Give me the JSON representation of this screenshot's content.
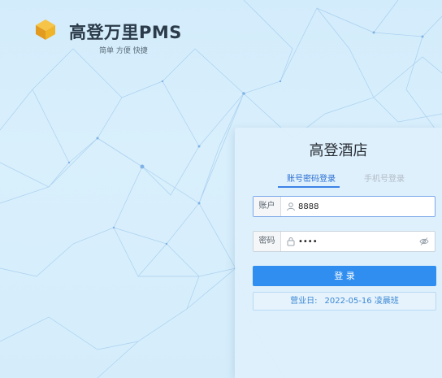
{
  "brand": {
    "name": "高登万里PMS",
    "slogan": "简单 方便 快捷",
    "logo_icon": "cube-logo-icon"
  },
  "login": {
    "hotel_name": "高登酒店",
    "tabs": [
      {
        "label": "账号密码登录",
        "active": true
      },
      {
        "label": "手机号登录",
        "active": false
      }
    ],
    "account": {
      "label": "账户",
      "value": "8888",
      "icon": "user-icon"
    },
    "password": {
      "label": "密码",
      "value": "1234",
      "icon": "lock-icon",
      "toggle_icon": "eye-off-icon"
    },
    "submit_label": "登 录",
    "business_day": {
      "label": "营业日:",
      "value": "2022-05-16 凌晨班"
    }
  },
  "colors": {
    "primary": "#2f8ef0",
    "background": "#d6eefc",
    "brand_gold": "#f0b429",
    "network_lines": "#9cc6ec"
  }
}
